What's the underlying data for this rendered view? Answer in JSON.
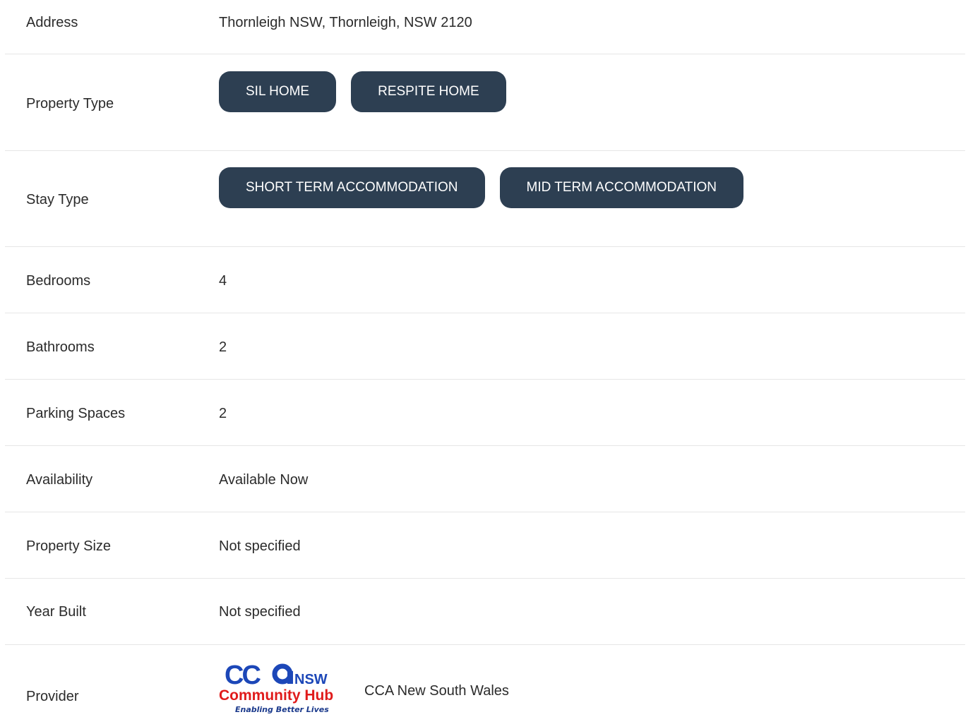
{
  "rows": {
    "address": {
      "label": "Address",
      "value": "Thornleigh NSW, Thornleigh, NSW 2120"
    },
    "property_type": {
      "label": "Property Type",
      "tags": [
        "SIL HOME",
        "RESPITE HOME"
      ]
    },
    "stay_type": {
      "label": "Stay Type",
      "tags": [
        "SHORT TERM ACCOMMODATION",
        "MID TERM ACCOMMODATION"
      ]
    },
    "bedrooms": {
      "label": "Bedrooms",
      "value": "4"
    },
    "bathrooms": {
      "label": "Bathrooms",
      "value": "2"
    },
    "parking": {
      "label": "Parking Spaces",
      "value": "2"
    },
    "availability": {
      "label": "Availability",
      "value": "Available Now"
    },
    "property_size": {
      "label": "Property Size",
      "value": "Not specified"
    },
    "year_built": {
      "label": "Year Built",
      "value": "Not specified"
    },
    "provider": {
      "label": "Provider",
      "name": "CCA New South Wales",
      "logo": {
        "cc": "CC",
        "nsw": "NSW",
        "hub": "Community Hub",
        "tagline": "Enabling Better Lives"
      }
    }
  },
  "colors": {
    "pill_bg": "#2d3f52",
    "pill_text": "#ffffff",
    "text": "#2b2b2b",
    "divider": "#e6e6e6",
    "logo_blue": "#1c47b8",
    "logo_red": "#e01b1b",
    "logo_navy": "#1b3a8c"
  }
}
